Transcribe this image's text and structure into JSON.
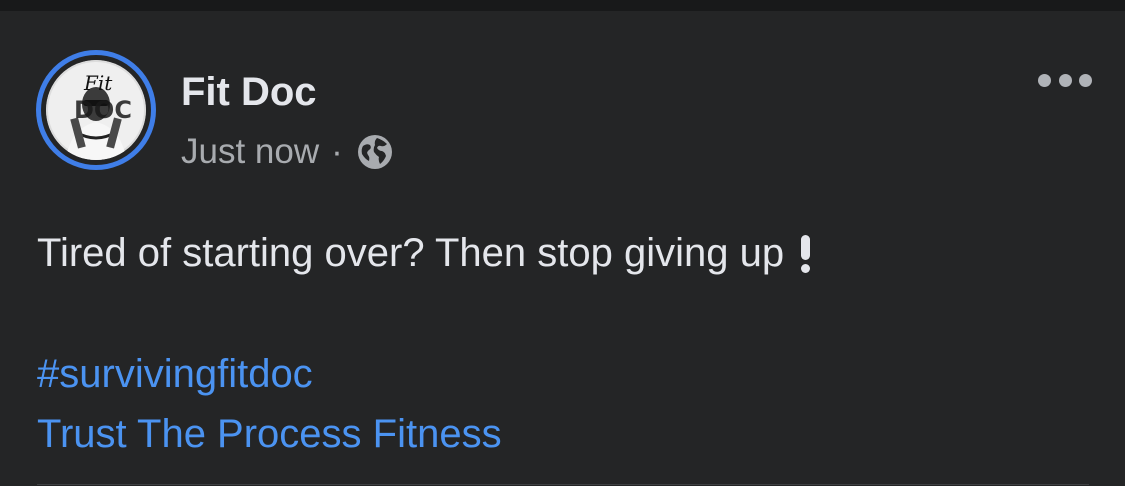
{
  "post": {
    "author": "Fit Doc",
    "timestamp": "Just now",
    "separator": "·",
    "audience_icon": "globe-icon",
    "more_icon": "more-options-icon",
    "text": "Tired of starting over? Then stop giving up",
    "emoji_icon": "exclamation-icon",
    "hashtag": "#survivingfitdoc",
    "page_link": "Trust The Process Fitness"
  },
  "avatar": {
    "logo_text": "Fit",
    "logo_text_2": "DOC"
  },
  "colors": {
    "background": "#242526",
    "text_primary": "#e4e6eb",
    "text_secondary": "#a8abaf",
    "link": "#4b93f1",
    "story_ring": "#3f7ee8"
  }
}
